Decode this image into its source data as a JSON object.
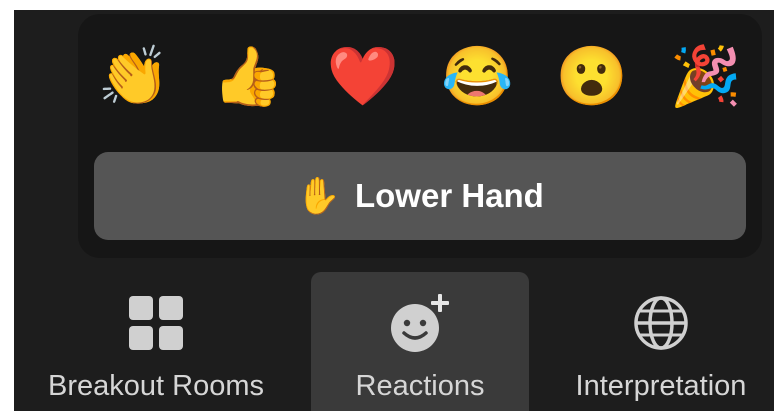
{
  "reactions": [
    {
      "name": "clap",
      "emoji": "👏"
    },
    {
      "name": "thumbs-up",
      "emoji": "👍"
    },
    {
      "name": "heart",
      "emoji": "❤️"
    },
    {
      "name": "tears-of-joy",
      "emoji": "😂"
    },
    {
      "name": "open-mouth",
      "emoji": "😮"
    },
    {
      "name": "party-popper",
      "emoji": "🎉"
    }
  ],
  "lower_hand": {
    "emoji": "✋",
    "label": "Lower Hand"
  },
  "toolbar": {
    "breakout_label": "Breakout Rooms",
    "reactions_label": "Reactions",
    "interpretation_label": "Interpretation"
  },
  "colors": {
    "toolbar_bg": "#1d1d1d",
    "popup_bg": "#161616",
    "lower_hand_bg": "#555555",
    "active_tool_bg": "#3a3a3a",
    "icon": "#d0d0d0"
  }
}
